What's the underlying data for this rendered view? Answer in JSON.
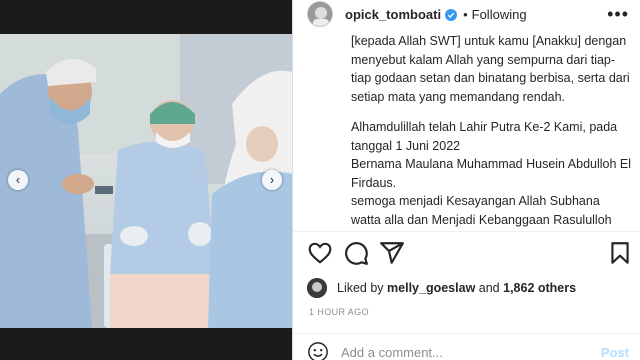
{
  "header": {
    "username": "opick_tomboati",
    "separator": "•",
    "follow_status": "Following",
    "more_label": "•••"
  },
  "caption": {
    "lines": [
      "[kepada Allah SWT] untuk kamu [Anakku] dengan menyebut kalam Allah yang sempurna dari tiap-tiap godaan setan dan binatang berbisa, serta dari setiap mata yang memandang rendah.",
      "Alhamdulillah telah Lahir Putra Ke-2 Kami, pada tanggal 1 Juni 2022",
      "Bernama Maulana Muhammad Husein Abdulloh El Firdaus.",
      "semoga menjadi Kesayangan Allah Subhana watta alla dan Menjadi Kebanggaan Rasululloh Sholallahu alaihi wasalam,Bahagia,Selamat dan Menyelamatkan Dunia dan Akhirat, Amin"
    ]
  },
  "likes": {
    "prefix": "Liked by",
    "user": "melly_goeslaw",
    "conjunction": "and",
    "count": "1,862 others"
  },
  "timestamp": "1 HOUR AGO",
  "comment": {
    "placeholder": "Add a comment...",
    "post_label": "Post"
  },
  "carousel": {
    "prev_icon": "chevron-left-icon",
    "next_icon": "chevron-right-icon",
    "slide_count": 7,
    "active_index": 0
  },
  "colors": {
    "verified": "#3897f0",
    "post_disabled": "#b2dffc",
    "scrub_blue": "#a9c6e3",
    "mask_green": "#5fa88f"
  }
}
